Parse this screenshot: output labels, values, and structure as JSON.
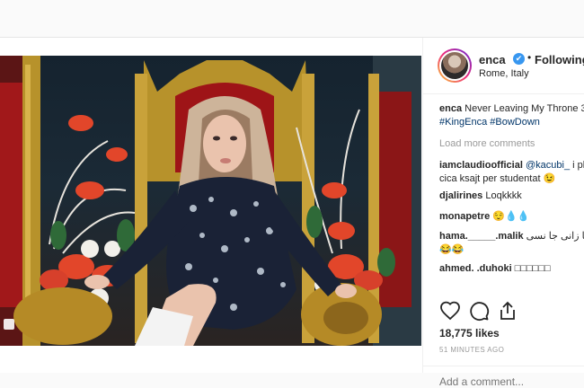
{
  "post": {
    "username": "enca",
    "verified_mark": "✔",
    "separator": "•",
    "follow_state": "Following",
    "location": "Rome, Italy",
    "likes": "18,775 likes",
    "timestamp": "51 MINUTES AGO",
    "add_comment_placeholder": "Add a comment...",
    "caption": {
      "user": "enca",
      "text": " Never Leaving My Throne 3",
      "tags": [
        "#KingEnca",
        "#BowDown"
      ]
    },
    "load_more": "Load more comments",
    "comments": [
      {
        "user": "iamclaudioofficial",
        "mention": "@kacubi_",
        "text": " i pl",
        "text2": "cica ksajt per studentat 😉"
      },
      {
        "user": "djalirines",
        "text": " Loqkkkk"
      },
      {
        "user": "monapetre",
        "text": " 😌💧💧"
      },
      {
        "user": "hama._____.malik",
        "text": " ﻪ ﺷﺎ ﺯﺍﻧﯽ ﺟﺎ ﻧﺴﯽ",
        "text2": "😂😂"
      },
      {
        "user": "ahmed. .duhoki",
        "text": " □□□□□□"
      }
    ]
  },
  "icons": [
    "heart-icon",
    "comment-icon",
    "share-icon",
    "gallery-icon"
  ]
}
